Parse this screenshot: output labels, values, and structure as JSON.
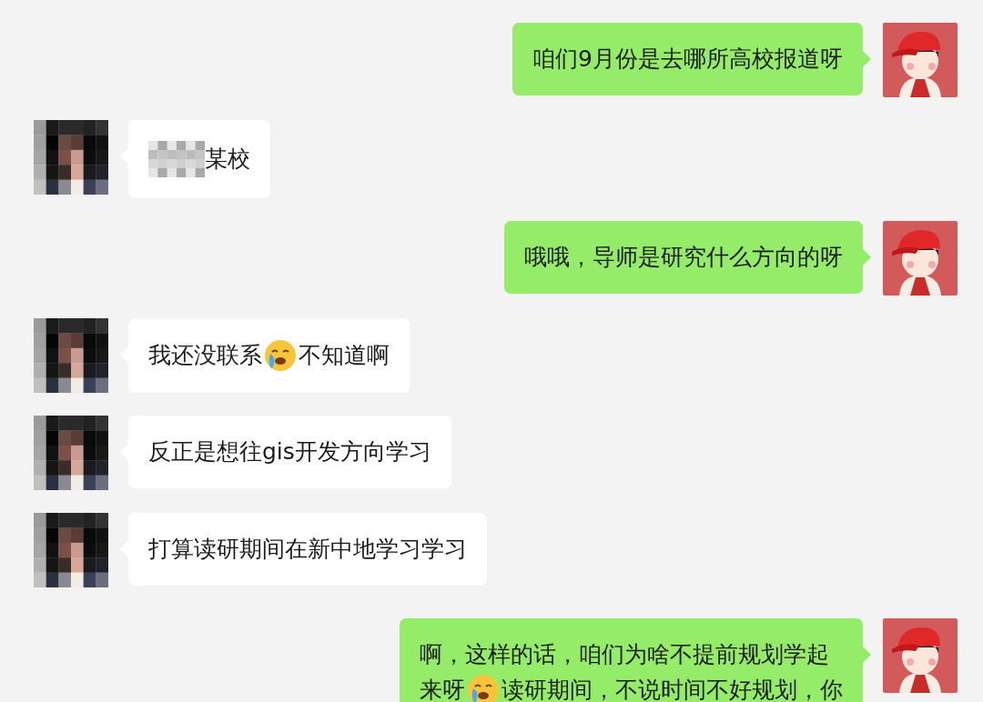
{
  "messages": [
    {
      "kind": "sent",
      "lines": [
        [
          {
            "kind": "text",
            "text": "咱们9月份是去哪所高校报道呀"
          }
        ]
      ]
    },
    {
      "kind": "received",
      "lines": [
        [
          {
            "kind": "redacted"
          },
          {
            "kind": "text",
            "text": "某校"
          }
        ]
      ]
    },
    {
      "kind": "sent",
      "lines": [
        [
          {
            "kind": "text",
            "text": "哦哦，导师是研究什么方向的呀"
          }
        ]
      ]
    },
    {
      "kind": "received",
      "lines": [
        [
          {
            "kind": "text",
            "text": "我还没联系"
          },
          {
            "kind": "emoji"
          },
          {
            "kind": "text",
            "text": "不知道啊"
          }
        ]
      ]
    },
    {
      "kind": "received",
      "lines": [
        [
          {
            "kind": "text",
            "text": "反正是想往gis开发方向学习"
          }
        ]
      ]
    },
    {
      "kind": "received",
      "lines": [
        [
          {
            "kind": "text",
            "text": "打算读研期间在新中地学习学习"
          }
        ]
      ]
    },
    {
      "kind": "sent",
      "lines": [
        [
          {
            "kind": "text",
            "text": "啊，这样的话，咱们为啥不提前规划学起"
          }
        ],
        [
          {
            "kind": "text",
            "text": "来呀"
          },
          {
            "kind": "emoji"
          },
          {
            "kind": "text",
            "text": "读研期间，不说时间不好规划，你"
          }
        ]
      ]
    }
  ]
}
